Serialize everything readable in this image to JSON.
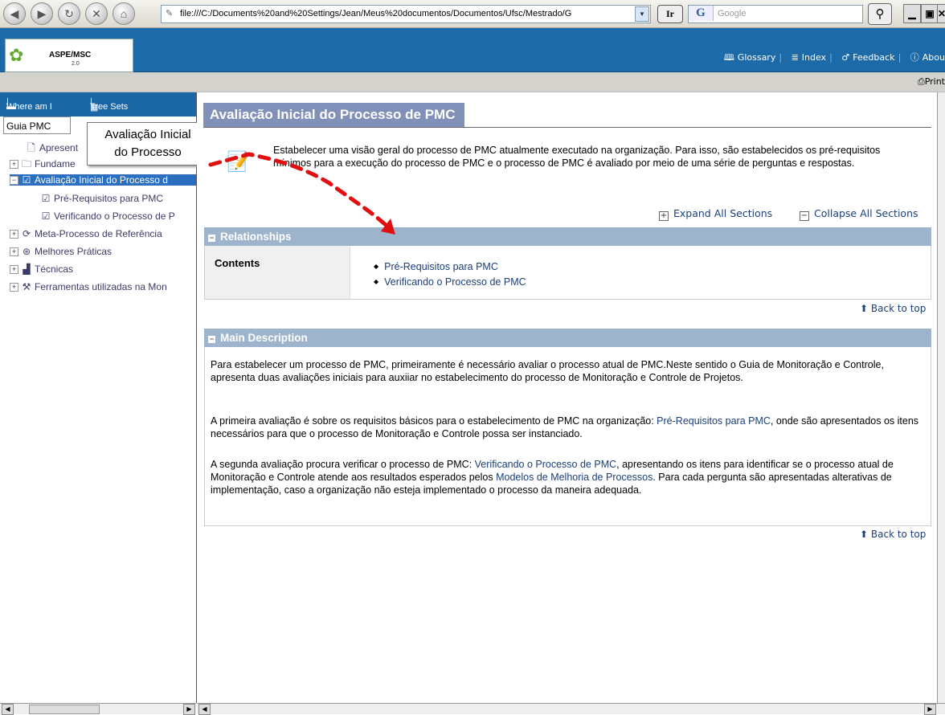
{
  "browser": {
    "back_icon": "back-arrow-icon",
    "forward_icon": "forward-arrow-icon",
    "reload_icon": "reload-icon",
    "stop_icon": "stop-icon",
    "home_icon": "home-icon",
    "address": "file:///C:/Documents%20and%20Settings/Jean/Meus%20documentos/Documentos/Ufsc/Mestrado/G",
    "ir_label": "Ir",
    "google_placeholder": "Google",
    "google_logo": "G"
  },
  "app": {
    "logo_name": "ASPE/MSC",
    "logo_version": "2.0",
    "links": {
      "glossary": "Glossary",
      "index": "Index",
      "feedback": "Feedback",
      "about": "Abou"
    },
    "print": "Print"
  },
  "left": {
    "tabs": {
      "where_am_i": "Where am I",
      "tree_sets": "Tree Sets"
    },
    "guia": "Guia PMC",
    "callout": [
      "Avaliação Inicial",
      "do Processo"
    ],
    "tree": [
      "Apresent",
      "Fundame",
      "Avaliação Inicial do Processo d",
      "Pré-Requisitos para PMC",
      "Verificando o Processo de P",
      "Meta-Processo de Referência",
      "Melhores Práticas",
      "Técnicas",
      "Ferramentas utilizadas na Mon"
    ]
  },
  "main": {
    "title": "Avaliação Inicial do Processo de PMC",
    "intro": "Estabelecer uma visão geral do processo de PMC atualmente executado na organização. Para isso, são estabelecidos os pré-requisitos mínimos para a execução do processo de PMC e o processo de PMC é avaliado por meio de uma série de perguntas e respostas.",
    "expand_all": "Expand All Sections",
    "collapse_all": "Collapse All Sections",
    "relationships": {
      "header": "Relationships",
      "label": "Contents",
      "items": [
        "Pré-Requisitos para PMC",
        "Verificando o Processo de PMC"
      ]
    },
    "back_to_top": "Back to top",
    "main_description": {
      "header": "Main Description",
      "p1": "Para estabelecer um processo de PMC, primeiramente é necessário avaliar o processo atual de PMC.Neste sentido o Guia de Monitoração e Controle, apresenta duas avaliações iniciais para auxiiar no estabelecimento do processo de Monitoração e Controle de Projetos.",
      "p2_a": "A primeira avaliação é sobre os requisitos básicos para o estabelecimento de PMC na organização: ",
      "p2_link": "Pré-Requisitos para PMC",
      "p2_b": ", onde são apresentados os itens necessários para que o processo de Monitoração e Controle possa ser instanciado.",
      "p3_a": "A segunda avaliação procura verificar o processo de PMC: ",
      "p3_link1": "Verificando o Processo de PMC",
      "p3_b": ", apresentando os itens para identificar se o processo atual de Monitoração e Controle atende aos resultados esperados pelos ",
      "p3_link2": "Modelos de Melhoria de Processos",
      "p3_c": ". Para cada pergunta são apresentadas alterativas de implementação, caso a organização não esteja implementado o processo da maneira adequada."
    }
  },
  "colors": {
    "header_blue": "#1d6aa8",
    "title_bg": "#8090b8",
    "section_bg": "#9db4cc",
    "link": "#1a3f7a",
    "arrow": "#e01010"
  }
}
